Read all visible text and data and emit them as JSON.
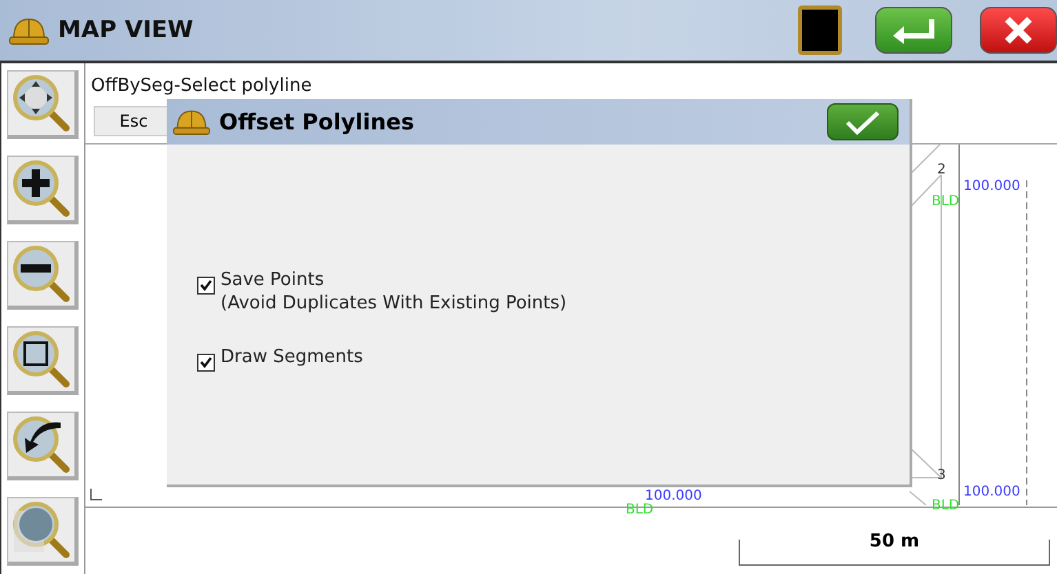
{
  "window": {
    "title": "MAP VIEW"
  },
  "prompt": "OffBySeg-Select polyline",
  "esc_button": "Esc",
  "map_labels": [
    {
      "kind": "point",
      "text": "2"
    },
    {
      "kind": "elevation",
      "text": "100.000"
    },
    {
      "kind": "code",
      "text": "BLD"
    },
    {
      "kind": "point",
      "text": "3"
    },
    {
      "kind": "elevation",
      "text": "100.000"
    },
    {
      "kind": "code",
      "text": "BLD"
    },
    {
      "kind": "elevation",
      "text": "100.000"
    },
    {
      "kind": "code",
      "text": "BLD"
    }
  ],
  "scale": "50 m",
  "dialog": {
    "title": "Offset Polylines",
    "options": [
      {
        "label": "Save Points",
        "note": "(Avoid Duplicates With Existing Points)",
        "checked": true
      },
      {
        "label": "Draw Segments",
        "checked": true
      }
    ]
  }
}
